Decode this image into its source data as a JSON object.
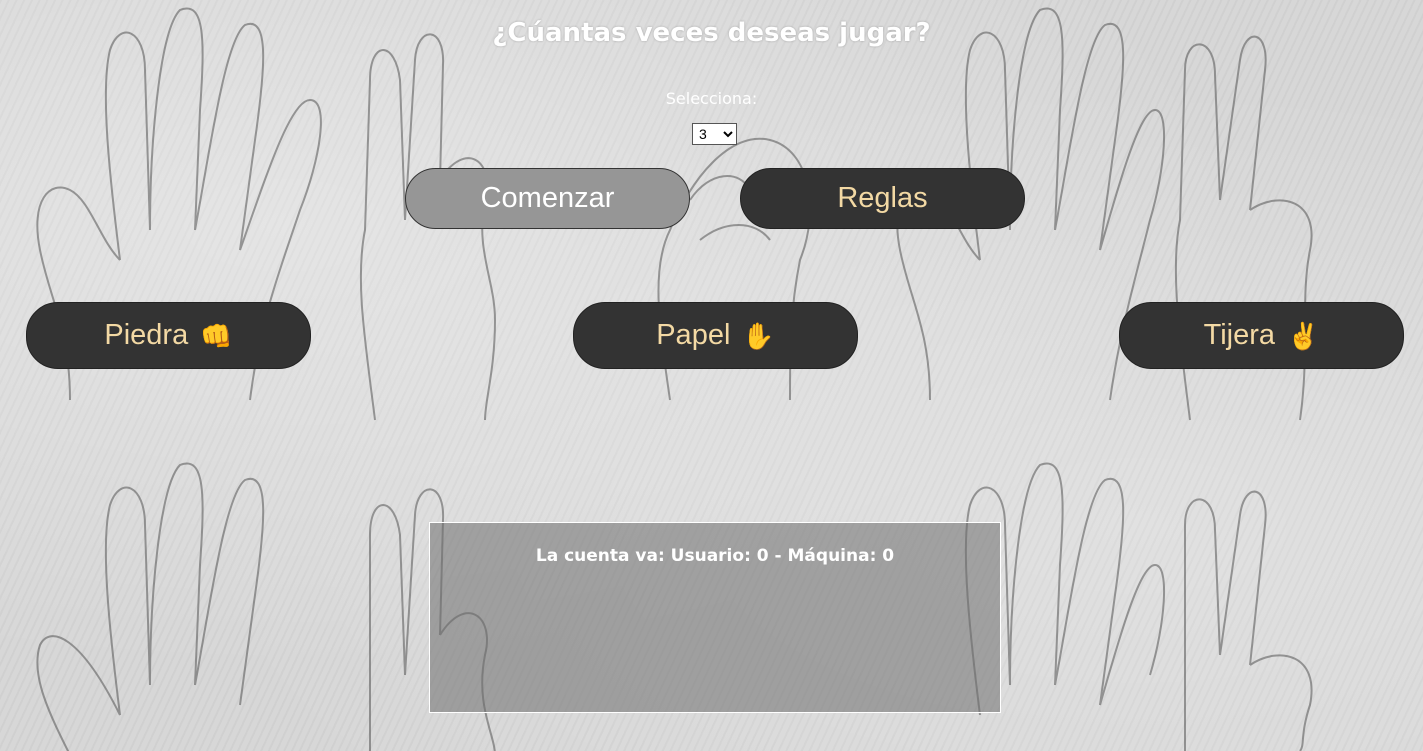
{
  "title": "¿Cúantas veces deseas jugar?",
  "select": {
    "label": "Selecciona:",
    "value": "3",
    "options": [
      "3"
    ]
  },
  "buttons": {
    "start": "Comenzar",
    "rules": "Reglas",
    "rock": {
      "label": "Piedra",
      "emoji": "👊"
    },
    "paper": {
      "label": "Papel",
      "emoji": "✋"
    },
    "scissors": {
      "label": "Tijera",
      "emoji": "✌️"
    }
  },
  "scoreboard": {
    "text": "La cuenta va: Usuario: 0 - Máquina: 0"
  },
  "colors": {
    "button_bg": "#333333",
    "button_text": "#f3d9a4",
    "start_bg": "#969696"
  }
}
